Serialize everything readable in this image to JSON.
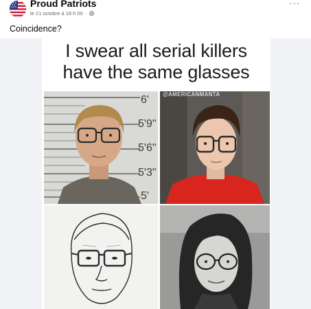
{
  "post": {
    "page_name": "Proud Patriots",
    "timestamp": "le 21 octobre à 18 h 00",
    "separator": "·",
    "privacy_icon": "globe-icon",
    "more_icon": "more-options-icon",
    "more_label": "···",
    "caption": "Coincidence?"
  },
  "meme": {
    "title_line1": "I swear all serial killers",
    "title_line2": "have the same glasses",
    "watermark": "@AMERICANMANTA",
    "height_marks": [
      "6'",
      "5'9\"",
      "5'6\"",
      "5'3\"",
      "5'"
    ],
    "panels": [
      {
        "name": "mugshot-photo",
        "description_icon": "mugshot"
      },
      {
        "name": "courtroom-photo",
        "description_icon": "portrait"
      },
      {
        "name": "police-sketch",
        "description_icon": "sketch"
      },
      {
        "name": "woman-photo",
        "description_icon": "portrait"
      }
    ]
  },
  "colors": {
    "text_primary": "#050505",
    "text_secondary": "#65676b",
    "media_background": "#f0f2f5",
    "jumpsuit_red": "#d8261f"
  }
}
